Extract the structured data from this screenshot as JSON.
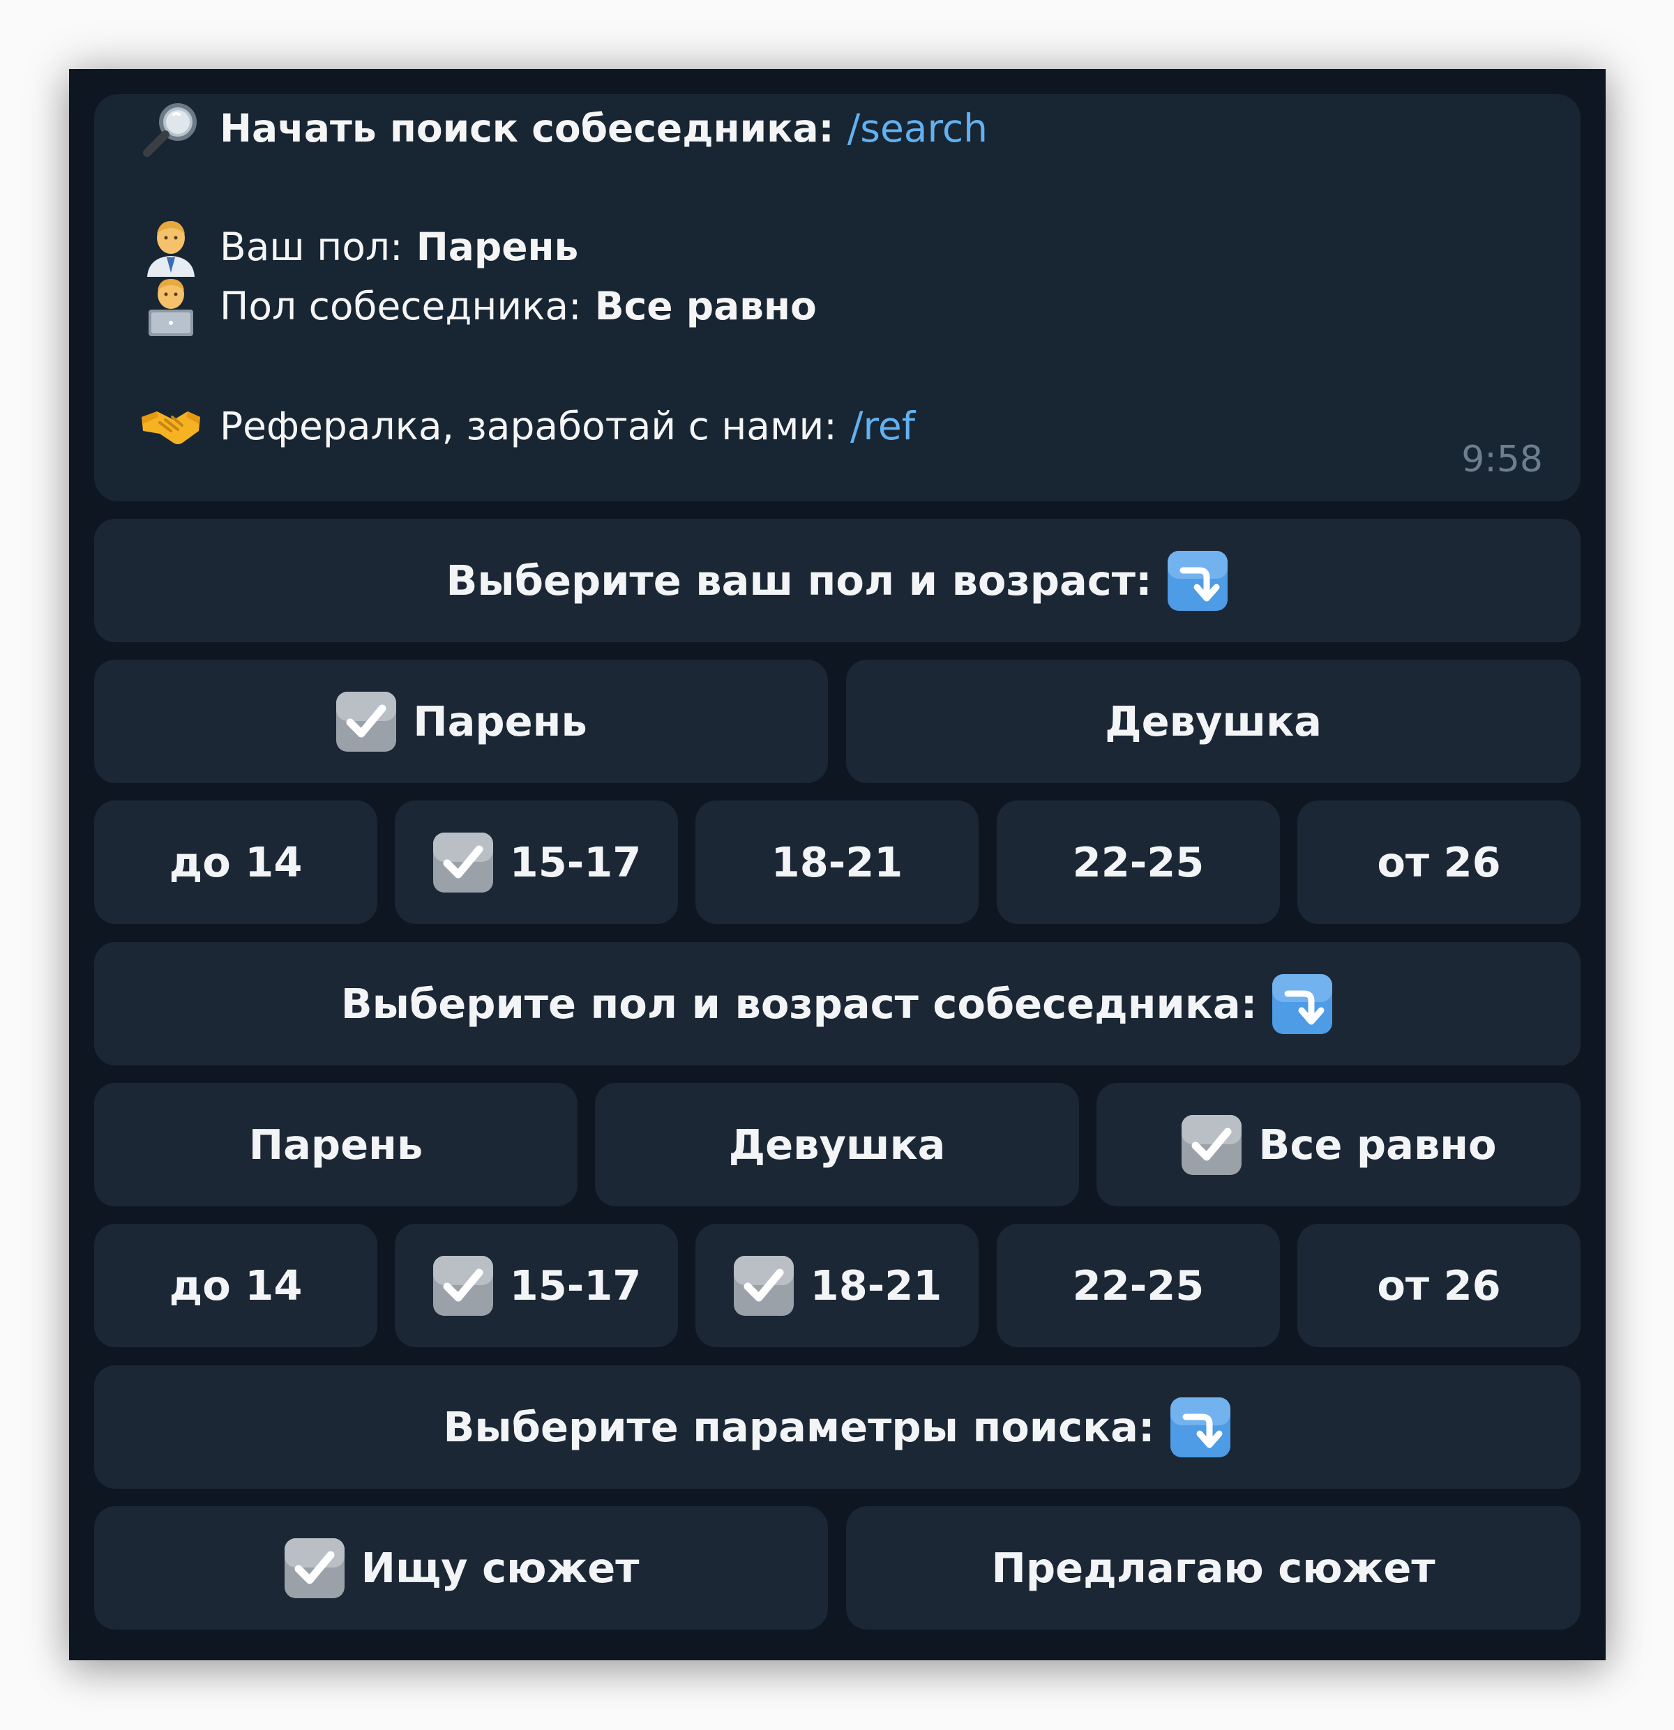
{
  "message": {
    "search_label": "Начать поиск собеседника:",
    "search_cmd": "/search",
    "your_gender_label": "Ваш пол:",
    "your_gender_value": "Парень",
    "partner_gender_label": "Пол собеседника:",
    "partner_gender_value": "Все равно",
    "referral_label": "Рефералка, заработай с нами:",
    "referral_cmd": "/ref",
    "time": "9:58",
    "icons": [
      "magnifying-glass-icon",
      "man-office-worker-icon",
      "man-technologist-icon",
      "handshake-icon"
    ]
  },
  "keyboard": {
    "your_header": "Выберите ваш пол и возраст:",
    "your_gender": [
      {
        "label": "Парень",
        "checked": true
      },
      {
        "label": "Девушка",
        "checked": false
      }
    ],
    "your_age": [
      {
        "label": "до 14",
        "checked": false
      },
      {
        "label": "15-17",
        "checked": true
      },
      {
        "label": "18-21",
        "checked": false
      },
      {
        "label": "22-25",
        "checked": false
      },
      {
        "label": "от 26",
        "checked": false
      }
    ],
    "partner_header": "Выберите пол и возраст собеседника:",
    "partner_gender": [
      {
        "label": "Парень",
        "checked": false
      },
      {
        "label": "Девушка",
        "checked": false
      },
      {
        "label": "Все равно",
        "checked": true
      }
    ],
    "partner_age": [
      {
        "label": "до 14",
        "checked": false
      },
      {
        "label": "15-17",
        "checked": true
      },
      {
        "label": "18-21",
        "checked": true
      },
      {
        "label": "22-25",
        "checked": false
      },
      {
        "label": "от 26",
        "checked": false
      }
    ],
    "params_header": "Выберите параметры поиска:",
    "params": [
      {
        "label": "Ищу сюжет",
        "checked": true
      },
      {
        "label": "Предлагаю сюжет",
        "checked": false
      }
    ]
  },
  "colors": {
    "window_bg": "#0e1621",
    "bubble_bg": "#182533",
    "button_bg": "#1b2735",
    "link": "#62b1f0",
    "time": "#6d7f8f"
  }
}
